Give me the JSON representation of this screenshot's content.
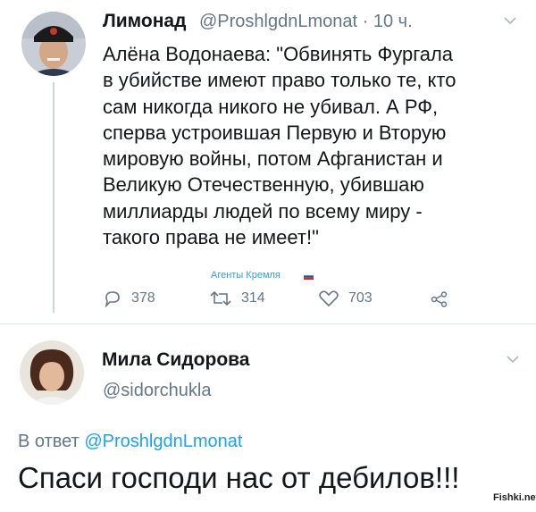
{
  "tweet": {
    "author_name": "Лимонад",
    "handle_time": "@ProshlgdnLmonat · 10 ч.",
    "text": "Алёна Водонаева: \"Обвинять Фургала\nв убийстве имеют право только те, кто\nсам никогда никого не убивал. А РФ,\nсперва устроившая Первую и Вторую\nмировую войны, потом Афганистан и\nВеликую Отечественную, убившаю\nмиллиарды людей по всему миру -\nтакого права не имеет!\"",
    "watermark": "Агенты Кремля",
    "replies": "378",
    "retweets": "314",
    "likes": "703"
  },
  "reply": {
    "author_name": "Мила Сидорова",
    "handle": "@sidorchukla",
    "reply_prefix": "В ответ",
    "reply_to": "@ProshlgdnLmonat",
    "text": "Спаси господи нас от дебилов!!!"
  },
  "site_watermark": "Fishki.net",
  "colors": {
    "muted": "#657786",
    "link": "#1da1f2",
    "text": "#14171a",
    "watermark_blue": "#2f9fd8"
  },
  "icons": [
    "reply-icon",
    "retweet-icon",
    "like-icon",
    "share-icon",
    "chevron-down-icon"
  ]
}
